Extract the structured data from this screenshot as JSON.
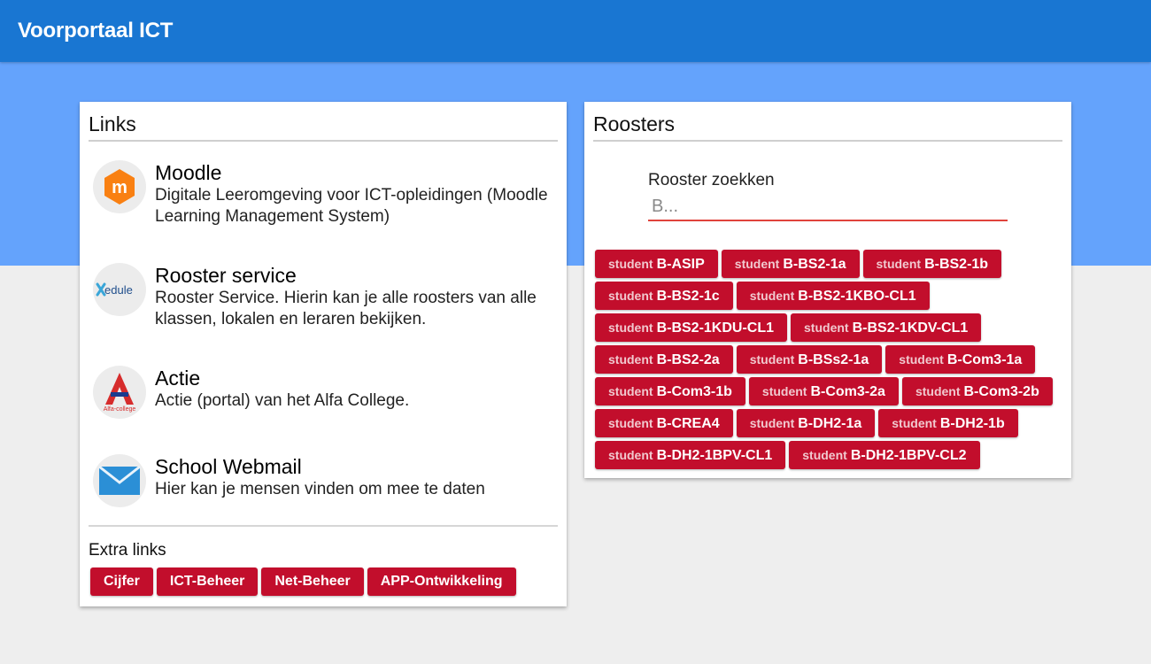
{
  "header": {
    "title": "Voorportaal ICT"
  },
  "colors": {
    "header": "#1976d2",
    "band": "#64a3fc",
    "button": "#c20e2c",
    "input_underline": "#e0433c"
  },
  "links_card": {
    "title": "Links",
    "items": [
      {
        "name": "Moodle",
        "desc": "Digitale Leeromgeving voor ICT-opleidingen (Moodle Learning Management System)",
        "icon": "moodle-logo"
      },
      {
        "name": "Rooster service",
        "desc": "Rooster Service. Hierin kan je alle roosters van alle klassen, lokalen en leraren bekijken.",
        "icon": "xedule-logo",
        "logo_text": "edule"
      },
      {
        "name": "Actie",
        "desc": "Actie (portal) van het Alfa College.",
        "icon": "alfa-college-logo",
        "logo_text": "Alfa-college"
      },
      {
        "name": "School Webmail",
        "desc": "Hier kan je mensen vinden om mee te daten",
        "icon": "mail-envelope-icon"
      }
    ],
    "extra_title": "Extra links",
    "extra_buttons": [
      "Cijfer",
      "ICT-Beheer",
      "Net-Beheer",
      "APP-Ontwikkeling"
    ]
  },
  "roosters_card": {
    "title": "Roosters",
    "search_label": "Rooster zoekken",
    "search_placeholder": "B...",
    "prefix": "student",
    "classes": [
      "B-ASIP",
      "B-BS2-1a",
      "B-BS2-1b",
      "B-BS2-1c",
      "B-BS2-1KBO-CL1",
      "B-BS2-1KDU-CL1",
      "B-BS2-1KDV-CL1",
      "B-BS2-2a",
      "B-BSs2-1a",
      "B-Com3-1a",
      "B-Com3-1b",
      "B-Com3-2a",
      "B-Com3-2b",
      "B-CREA4",
      "B-DH2-1a",
      "B-DH2-1b",
      "B-DH2-1BPV-CL1",
      "B-DH2-1BPV-CL2"
    ]
  }
}
